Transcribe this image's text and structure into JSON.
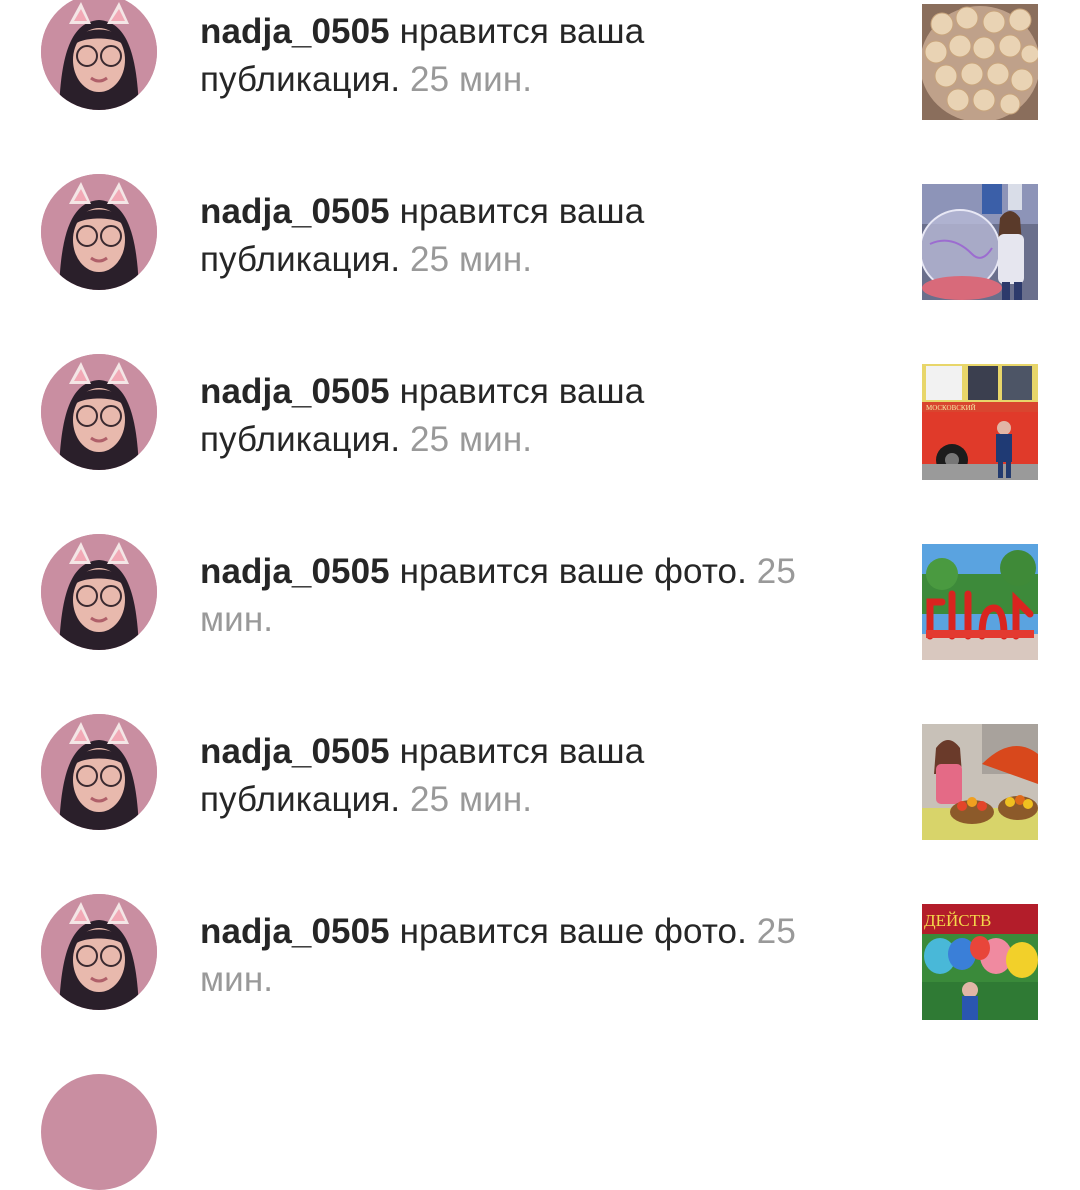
{
  "notifications": [
    {
      "username": "nadja_0505",
      "action": "нравится ваша публикация.",
      "time": "25 мин.",
      "thumbnail": "cookies-photo"
    },
    {
      "username": "nadja_0505",
      "action": "нравится ваша публикация.",
      "time": "25 мин.",
      "thumbnail": "girl-plasma-ball-photo"
    },
    {
      "username": "nadja_0505",
      "action": "нравится ваша публикация.",
      "time": "25 мин.",
      "thumbnail": "red-bus-photo"
    },
    {
      "username": "nadja_0505",
      "action": "нравится ваше фото.",
      "time": "25 мин.",
      "thumbnail": "red-letters-sculpture-photo"
    },
    {
      "username": "nadja_0505",
      "action": "нравится ваша публикация.",
      "time": "25 мин.",
      "thumbnail": "girl-fruit-stand-photo"
    },
    {
      "username": "nadja_0505",
      "action": "нравится ваше фото.",
      "time": "25 мин.",
      "thumbnail": "balloons-photo"
    }
  ],
  "thumbnail_texts": {
    "bus_sign": "МОСКОВСКИЙ",
    "balloons_sign": "ДЕЙСТВ"
  }
}
